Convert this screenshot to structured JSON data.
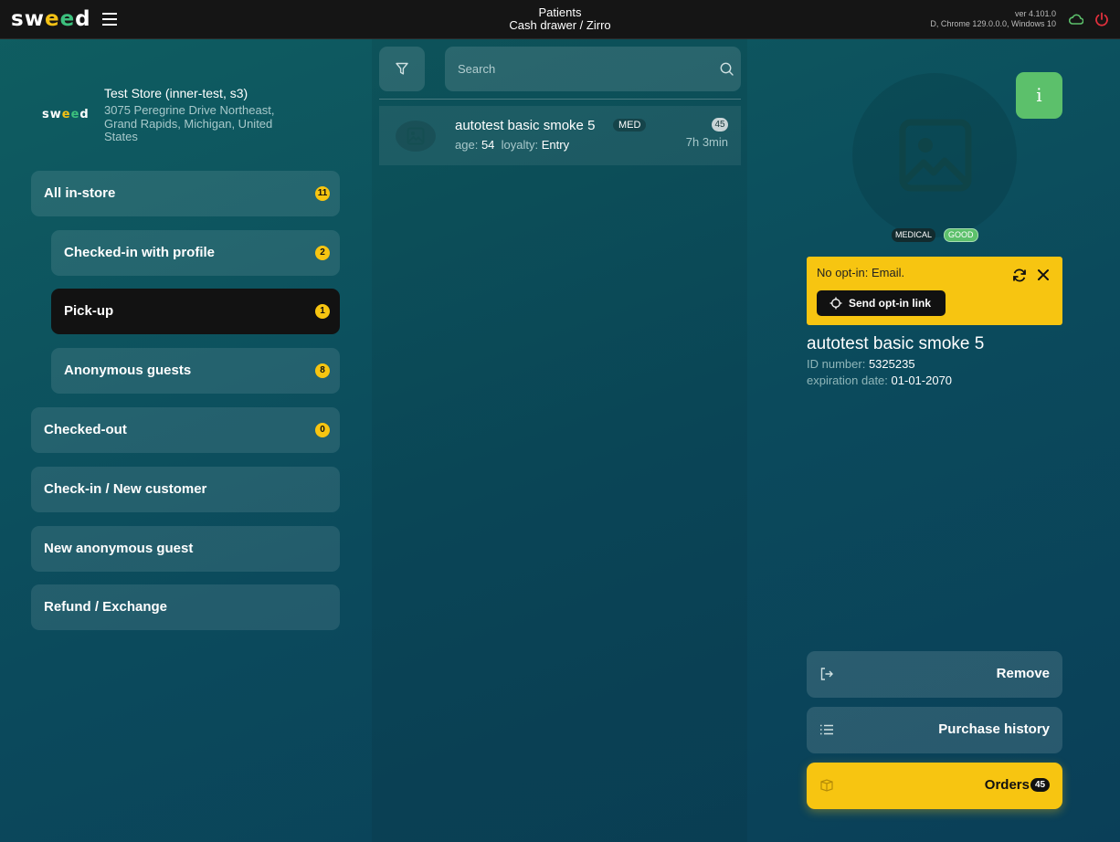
{
  "app": {
    "logo": "sweed",
    "title": "Patients",
    "subtitle": "Cash drawer / Zirro",
    "version": "ver 4.101.0",
    "env": "D, Chrome 129.0.0.0, Windows 10"
  },
  "store": {
    "logo_text": "sweed",
    "name": "Test Store (inner-test, s3)",
    "address": "3075 Peregrine Drive Northeast, Grand Rapids, Michigan, United States"
  },
  "nav": {
    "all_in_store": {
      "label": "All in-store",
      "count": "11"
    },
    "checked_in_profile": {
      "label": "Checked-in with profile",
      "count": "2"
    },
    "pickup": {
      "label": "Pick-up",
      "count": "1"
    },
    "anonymous": {
      "label": "Anonymous guests",
      "count": "8"
    },
    "checked_out": {
      "label": "Checked-out",
      "count": "0"
    },
    "check_in_new": {
      "label": "Check-in / New customer"
    },
    "new_anon": {
      "label": "New anonymous guest"
    },
    "refund": {
      "label": "Refund / Exchange"
    }
  },
  "search": {
    "placeholder": "Search"
  },
  "patients": [
    {
      "name": "autotest basic smoke 5",
      "tag": "MED",
      "age_label": "age:",
      "age": "54",
      "loyalty_label": "loyalty:",
      "loyalty": "Entry",
      "count": "45",
      "time": "7h 3min"
    }
  ],
  "detail": {
    "info_label": "i",
    "tag_medical": "MEDICAL",
    "tag_good": "GOOD",
    "optin_message": "No opt-in: Email.",
    "send_optin_label": "Send opt-in link",
    "name": "autotest basic smoke 5",
    "id_label": "ID number:",
    "id_value": "5325235",
    "exp_label": "expiration date:",
    "exp_value": "01-01-2070"
  },
  "actions": {
    "remove": "Remove",
    "purchase_history": "Purchase history",
    "orders": "Orders",
    "orders_count": "45"
  },
  "colors": {
    "accent_yellow": "#f7c511",
    "accent_green": "#5cc06b",
    "power_red": "#e0303c"
  }
}
